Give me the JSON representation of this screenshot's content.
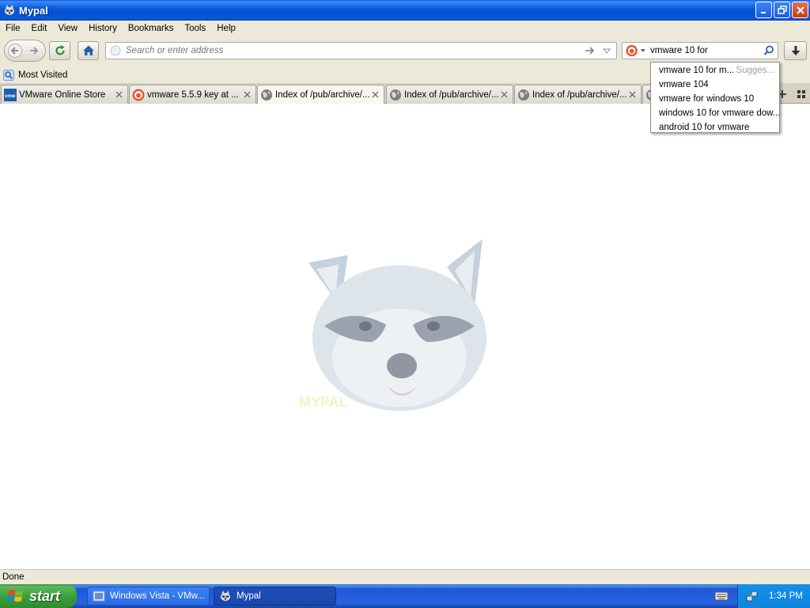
{
  "window": {
    "title": "Mypal"
  },
  "menu": [
    "File",
    "Edit",
    "View",
    "History",
    "Bookmarks",
    "Tools",
    "Help"
  ],
  "address_bar": {
    "placeholder": "Search or enter address",
    "value": ""
  },
  "search_bar": {
    "value": "vmware 10 for "
  },
  "bookmarks": [
    {
      "label": "Most Visited"
    }
  ],
  "tabs": [
    {
      "label": "VMware Online Store",
      "icon": "vmware-icon"
    },
    {
      "label": "vmware 5.5.9 key at ...",
      "icon": "duckduckgo-icon"
    },
    {
      "label": "Index of /pub/archive/...",
      "icon": "globe-icon"
    },
    {
      "label": "Index of /pub/archive/...",
      "icon": "globe-icon"
    },
    {
      "label": "Index of /pub/archive/...",
      "icon": "globe-icon"
    }
  ],
  "suggestions": {
    "hint": "Sugges...",
    "items": [
      "vmware 10 for m...",
      "vmware 104",
      "vmware for windows 10",
      "windows 10 for vmware dow...",
      "android 10 for vmware"
    ]
  },
  "status": {
    "text": "Done"
  },
  "taskbar": {
    "start_label": "start",
    "items": [
      {
        "label": "Windows Vista - VMw...",
        "active": false
      },
      {
        "label": "Mypal",
        "active": true
      }
    ],
    "clock": "1:34 PM"
  },
  "colors": {
    "title_bar": "#0a5ce6",
    "chrome": "#ece9d8",
    "taskbar": "#2663e0",
    "start_button": "#38a238",
    "tray": "#1290e8"
  }
}
